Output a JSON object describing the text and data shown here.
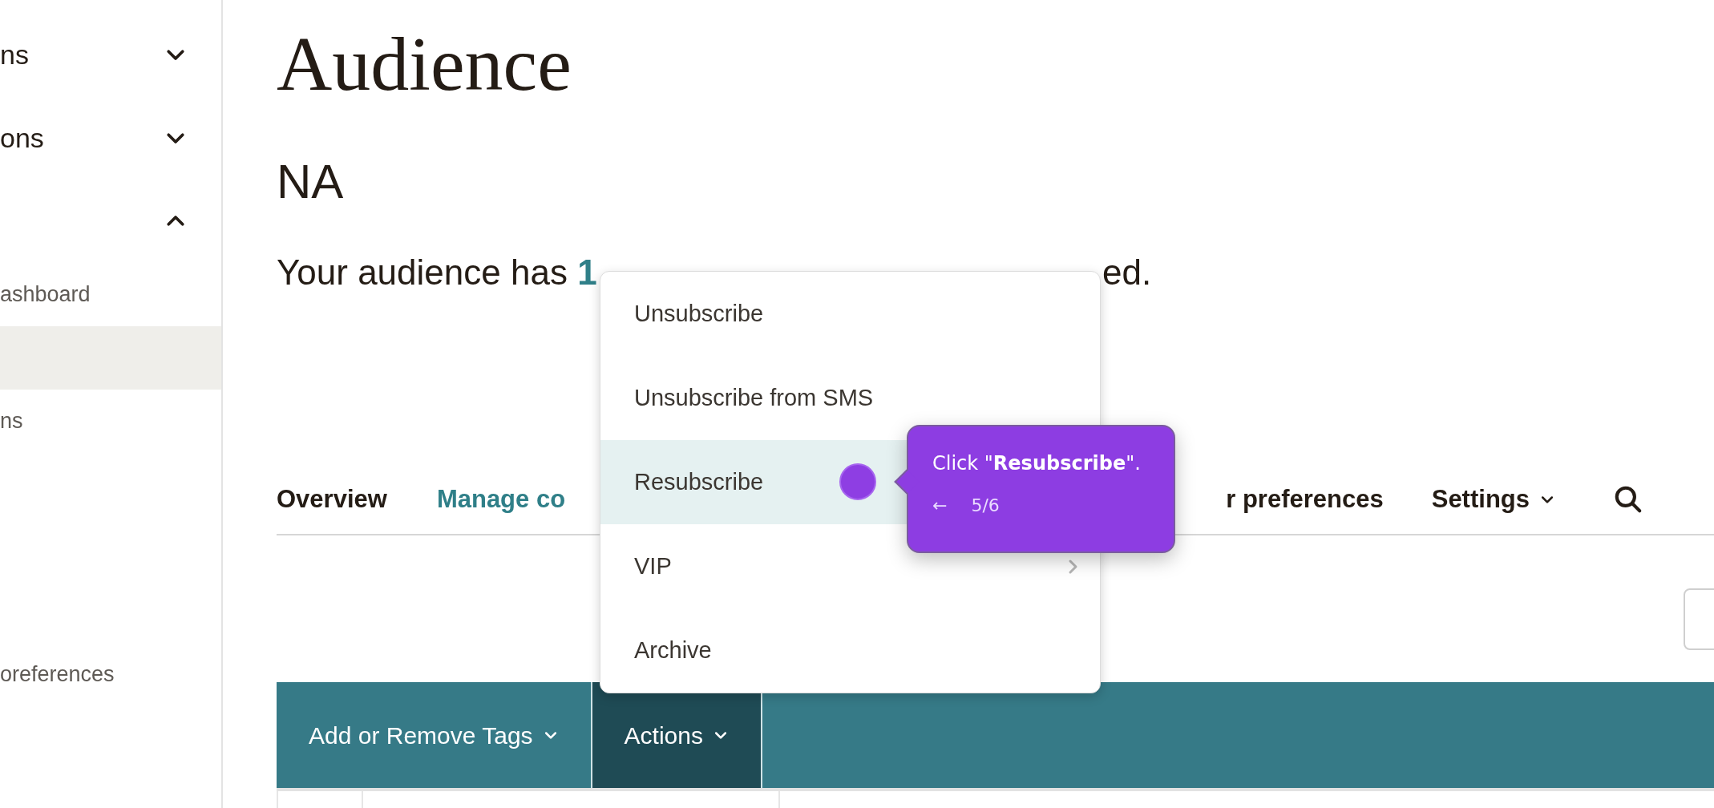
{
  "sidebar": {
    "items": [
      {
        "label": "ns",
        "expanded": false
      },
      {
        "label": "ons",
        "expanded": false
      },
      {
        "expanded": true,
        "children": [
          {
            "label": "ashboard",
            "selected": false
          },
          {
            "selected": true
          },
          {
            "label": "ns",
            "selected": false
          },
          {
            "label": "oreferences",
            "selected": false
          }
        ]
      }
    ]
  },
  "page": {
    "title": "Audience",
    "audience_name": "NA",
    "summary_visible_start": "Your audience has **1**",
    "summary_visible_end": "ed."
  },
  "tabs": [
    {
      "label": "Overview",
      "selected": false
    },
    {
      "label": "Manage co",
      "selected": true
    },
    {
      "label": "r preferences",
      "selected": false
    },
    {
      "label": "Settings",
      "selected": false,
      "kind": "menu"
    }
  ],
  "toolbar": {
    "buttons": [
      {
        "label": "Add or Remove Tags",
        "expanded": false
      },
      {
        "label": "Actions",
        "expanded": true
      }
    ]
  },
  "actions_menu": {
    "items": [
      {
        "label": "Unsubscribe",
        "selected": false,
        "kind": "action"
      },
      {
        "label": "Unsubscribe from SMS",
        "selected": false,
        "kind": "action"
      },
      {
        "label": "Resubscribe",
        "selected": true,
        "kind": "action"
      },
      {
        "label": "VIP",
        "selected": false,
        "kind": "submenu"
      },
      {
        "label": "Archive",
        "selected": false,
        "kind": "action"
      }
    ]
  },
  "guide_tooltip": {
    "text": "Click \"**Resubscribe**\".",
    "back": "←",
    "step": "5/6"
  }
}
